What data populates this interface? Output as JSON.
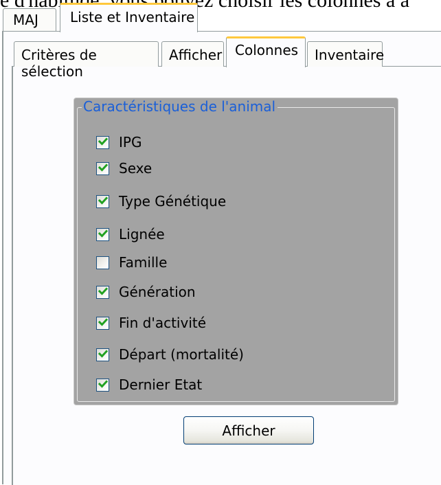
{
  "document_text": "e d'habitude, vous pouvez choisir les colonnes à a",
  "outer_tabs": [
    {
      "label": "MAJ",
      "active": false
    },
    {
      "label": "Liste et Inventaire",
      "active": true
    }
  ],
  "inner_tabs": [
    {
      "label": "Critères de sélection",
      "active": false
    },
    {
      "label": "Afficher",
      "active": false
    },
    {
      "label": "Colonnes",
      "active": true
    },
    {
      "label": "Inventaire",
      "active": false
    }
  ],
  "groupbox": {
    "title": "Caractéristiques de l'animal",
    "items": [
      {
        "label": "IPG",
        "checked": true
      },
      {
        "label": "Sexe",
        "checked": true
      },
      {
        "label": "Type Génétique",
        "checked": true
      },
      {
        "label": "Lignée",
        "checked": true
      },
      {
        "label": "Famille",
        "checked": false
      },
      {
        "label": "Génération",
        "checked": true
      },
      {
        "label": "Fin d'activité",
        "checked": true
      },
      {
        "label": "Départ (mortalité)",
        "checked": true
      },
      {
        "label": "Dernier Etat",
        "checked": true
      }
    ]
  },
  "button": {
    "label": "Afficher"
  },
  "colors": {
    "check": "#21a121",
    "groupbox_bg": "#a3a3a3",
    "groupbox_title": "#1a5fd8",
    "active_tab_accent": "#ffc83c"
  }
}
